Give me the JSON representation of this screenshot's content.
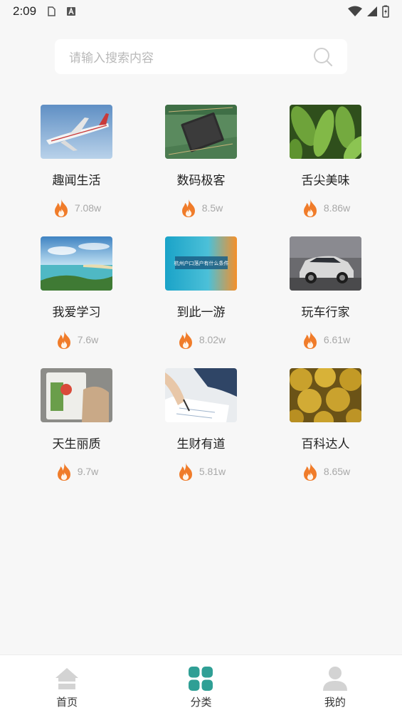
{
  "status_bar": {
    "time": "2:09"
  },
  "search": {
    "placeholder": "请输入搜索内容"
  },
  "categories": [
    {
      "title": "趣闻生活",
      "heat": "7.08w",
      "thumb": "airplane"
    },
    {
      "title": "数码极客",
      "heat": "8.5w",
      "thumb": "chip"
    },
    {
      "title": "舌尖美味",
      "heat": "8.86w",
      "thumb": "edamame"
    },
    {
      "title": "我爱学习",
      "heat": "7.6w",
      "thumb": "sea"
    },
    {
      "title": "到此一游",
      "heat": "8.02w",
      "thumb": "banner",
      "thumb_text": "杭州户口落户有什么条件"
    },
    {
      "title": "玩车行家",
      "heat": "6.61w",
      "thumb": "car"
    },
    {
      "title": "天生丽质",
      "heat": "9.7w",
      "thumb": "package"
    },
    {
      "title": "生财有道",
      "heat": "5.81w",
      "thumb": "writing"
    },
    {
      "title": "百科达人",
      "heat": "8.65w",
      "thumb": "durian"
    }
  ],
  "bottom_nav": {
    "items": [
      {
        "label": "首页",
        "icon": "home-icon",
        "active": false
      },
      {
        "label": "分类",
        "icon": "grid-icon",
        "active": true
      },
      {
        "label": "我的",
        "icon": "user-icon",
        "active": false
      }
    ]
  },
  "colors": {
    "accent": "#2f9f95",
    "fire": "#f07c2a",
    "inactive_icon": "#d3d3d3"
  }
}
